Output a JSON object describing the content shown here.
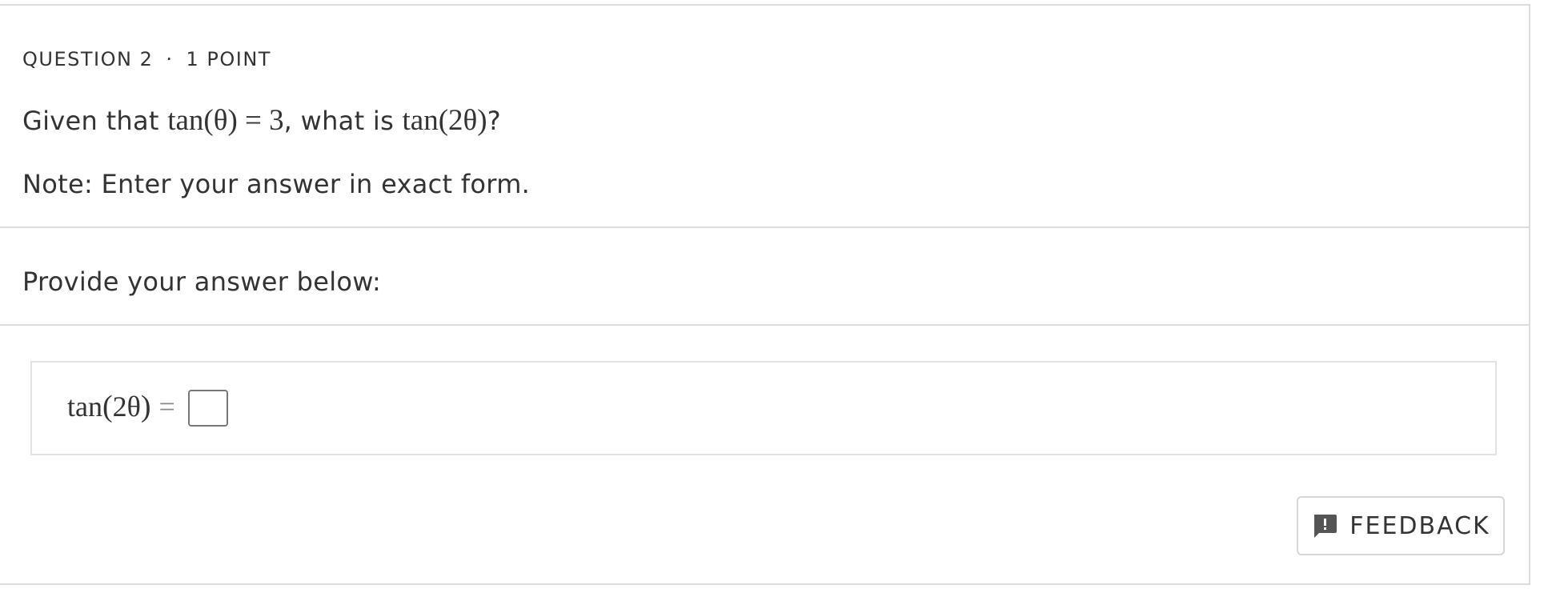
{
  "question": {
    "number_label": "QUESTION 2",
    "separator": "·",
    "points_label": "1 POINT",
    "prompt_prefix": "Given that ",
    "prompt_math_1": "tan(θ) = 3",
    "prompt_middle": ", what is ",
    "prompt_math_2": "tan(2θ)",
    "prompt_suffix": "?",
    "note": "Note: Enter your answer in exact form."
  },
  "answer_section": {
    "instruction": "Provide your answer below:",
    "expression_fn": "tan",
    "expression_arg": "2θ",
    "expression_eq": "=",
    "input_value": ""
  },
  "feedback": {
    "label": "FEEDBACK",
    "icon": "feedback-icon"
  }
}
